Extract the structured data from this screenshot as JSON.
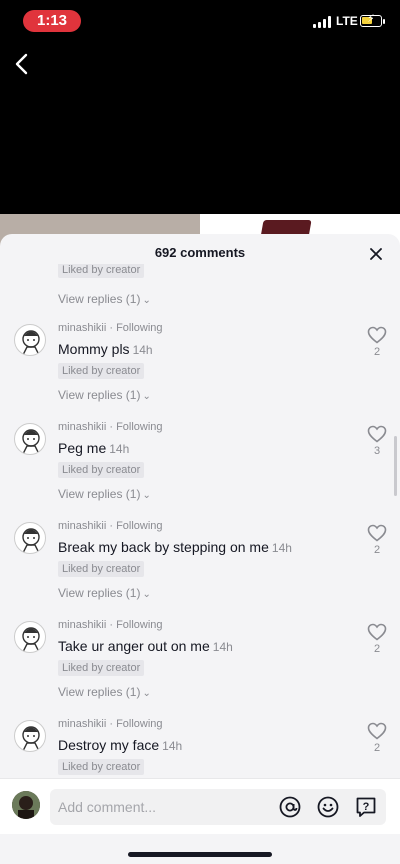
{
  "status": {
    "time": "1:13",
    "network": "LTE"
  },
  "sheet": {
    "title": "692 comments"
  },
  "partial_comment": {
    "liked_label": "Liked by creator",
    "replies_label": "View replies (1)"
  },
  "comments": [
    {
      "username": "minashikii · Following",
      "text": "Mommy pls",
      "time": "14h",
      "liked_label": "Liked by creator",
      "replies_label": "View replies (1)",
      "likes": "2"
    },
    {
      "username": "minashikii · Following",
      "text": "Peg me",
      "time": "14h",
      "liked_label": "Liked by creator",
      "replies_label": "View replies (1)",
      "likes": "3"
    },
    {
      "username": "minashikii · Following",
      "text": "Break my back by stepping on me",
      "time": "14h",
      "liked_label": "Liked by creator",
      "replies_label": "View replies (1)",
      "likes": "2"
    },
    {
      "username": "minashikii · Following",
      "text": "Take ur anger out on me",
      "time": "14h",
      "liked_label": "Liked by creator",
      "replies_label": "View replies (1)",
      "likes": "2"
    },
    {
      "username": "minashikii · Following",
      "text": "Destroy my face",
      "time": "14h",
      "liked_label": "Liked by creator",
      "replies_label": "",
      "likes": "2"
    }
  ],
  "input": {
    "placeholder": "Add comment..."
  },
  "icons": {
    "back": "chevron-left-icon",
    "close": "close-icon",
    "like": "heart-outline-icon",
    "mention": "at-sign-icon",
    "emoji": "emoji-icon",
    "question": "question-sticker-icon"
  },
  "colors": {
    "time_pill": "#e0343c",
    "sheet_bg": "#f4f4f6",
    "text_primary": "#161823",
    "text_secondary": "#8a8b91"
  }
}
